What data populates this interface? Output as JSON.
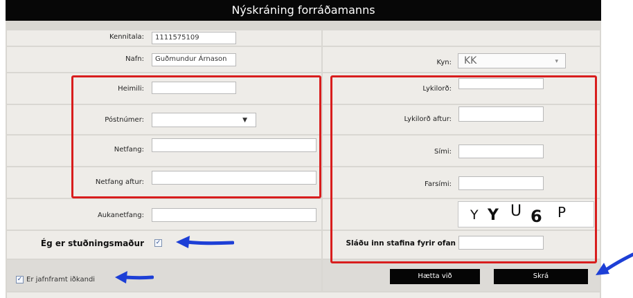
{
  "title": "Nýskráning forráðamanns",
  "fields": {
    "kennitala": {
      "label": "Kennitala:",
      "value": "1111575109"
    },
    "nafn": {
      "label": "Nafn:",
      "value": "Guðmundur Árnason"
    },
    "kyn": {
      "label": "Kyn:",
      "value": "KK"
    },
    "heimili": {
      "label": "Heimili:",
      "value": ""
    },
    "postnumer": {
      "label": "Póstnúmer:",
      "value": ""
    },
    "netfang": {
      "label": "Netfang:",
      "value": ""
    },
    "netfang_aftur": {
      "label": "Netfang aftur:",
      "value": ""
    },
    "aukanetfang": {
      "label": "Aukanetfang:",
      "value": ""
    },
    "lykilord": {
      "label": "Lykilorð:",
      "value": ""
    },
    "lykilord_aftur": {
      "label": "Lykilorð aftur:",
      "value": ""
    },
    "simi": {
      "label": "Sími:",
      "value": ""
    },
    "farsimi": {
      "label": "Farsími:",
      "value": ""
    }
  },
  "captcha": {
    "chars": [
      "Y",
      "Y",
      "U",
      "6",
      "P"
    ],
    "label": "Sláðu inn stafina fyrir ofan",
    "value": ""
  },
  "studningsmadur": {
    "label": "Ég er stuðningsmaður",
    "checked": true
  },
  "idkandi": {
    "label": "Er jafnframt iðkandi",
    "checked": true
  },
  "buttons": {
    "cancel": "Hætta við",
    "submit": "Skrá"
  },
  "colors": {
    "highlight_box": "#d81d1d",
    "arrow": "#1d3fd6",
    "header_bg": "#070707"
  }
}
